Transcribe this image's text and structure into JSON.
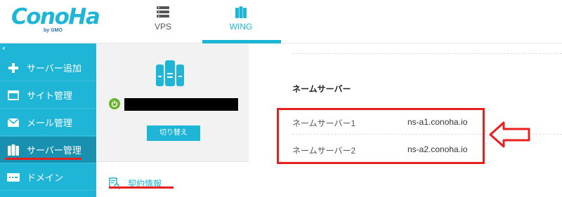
{
  "logo": {
    "text": "ConoHa",
    "sub": "by GMO"
  },
  "nav": {
    "tabs": [
      {
        "label": "VPS",
        "icon": "server-stack-icon"
      },
      {
        "label": "WING",
        "icon": "wing-server-icon"
      }
    ],
    "active": "WING"
  },
  "sidebar": {
    "collapse_icon": "‹",
    "items": [
      {
        "label": "サーバー追加",
        "icon": "plus-icon"
      },
      {
        "label": "サイト管理",
        "icon": "window-icon"
      },
      {
        "label": "メール管理",
        "icon": "mail-icon"
      },
      {
        "label": "サーバー管理",
        "icon": "server-icon"
      },
      {
        "label": "ドメイン",
        "icon": "domain-icon"
      }
    ],
    "active_item": "サーバー管理"
  },
  "server_panel": {
    "switch_button": "切り替え",
    "contract_tab": "契約情報"
  },
  "nameserver": {
    "title": "ネームサーバー",
    "rows": [
      {
        "label": "ネームサーバー1",
        "value": "ns-a1.conoha.io"
      },
      {
        "label": "ネームサーバー2",
        "value": "ns-a2.conoha.io"
      }
    ]
  },
  "colors": {
    "accent": "#1fb5d6",
    "sidebar_active": "#1a90b0",
    "highlight": "#e81f1f",
    "power": "#69b42e"
  }
}
